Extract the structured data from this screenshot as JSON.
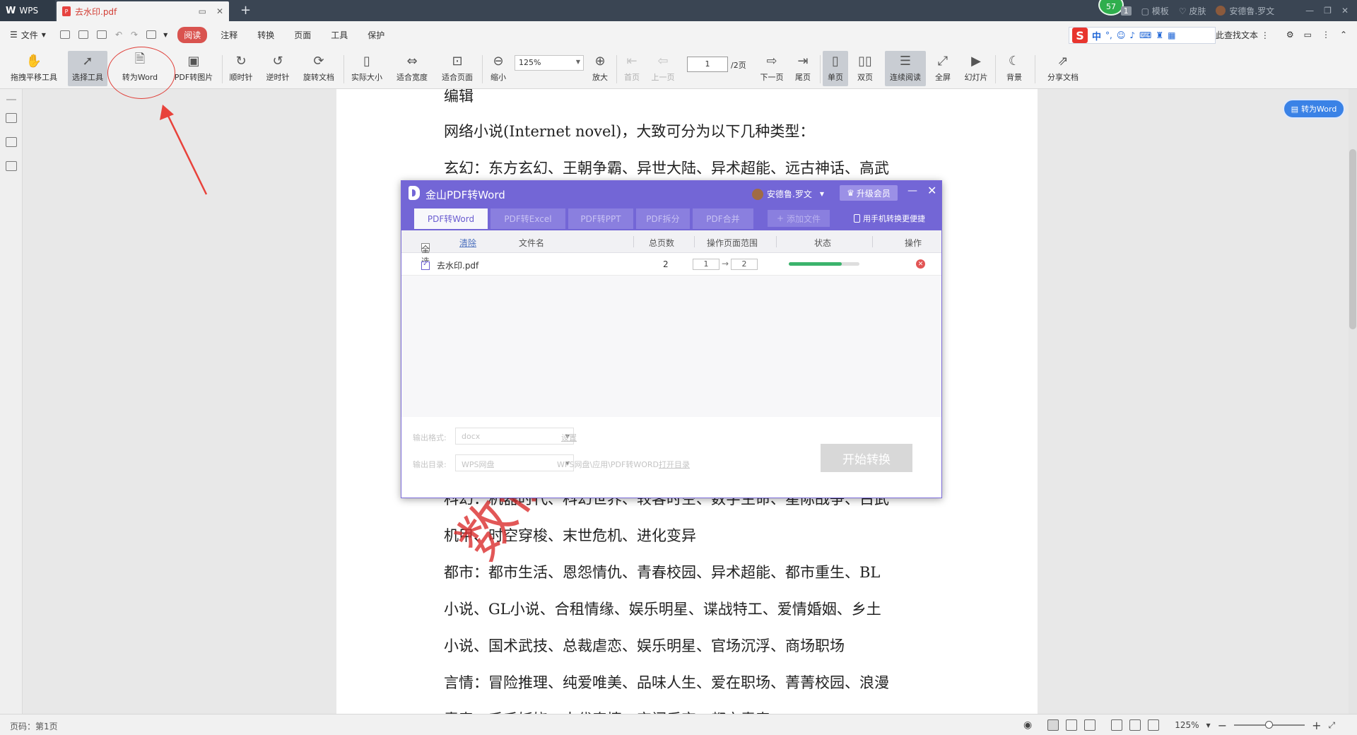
{
  "titlebar": {
    "app_tab": "WPS",
    "doc_tab_title": "去水印.pdf",
    "add_tab": "+",
    "notification_count": "1",
    "green_badge": "57",
    "template": "模板",
    "skin": "皮肤",
    "user_name": "安德鲁.罗文"
  },
  "menubar": {
    "file": "文件",
    "items": [
      "阅读",
      "注释",
      "转换",
      "页面",
      "工具",
      "保护"
    ],
    "find_text": "此查找文本",
    "ime_chinese": "中"
  },
  "toolbar": {
    "tools": [
      {
        "label": "拖拽平移工具",
        "icon": "hand-icon"
      },
      {
        "label": "选择工具",
        "icon": "cursor-icon"
      },
      {
        "label": "转为Word",
        "icon": "pdf-to-word-icon"
      },
      {
        "label": "PDF转图片",
        "icon": "pdf-to-image-icon"
      },
      {
        "label": "顺时针",
        "icon": "rotate-cw-icon"
      },
      {
        "label": "逆时针",
        "icon": "rotate-ccw-icon"
      },
      {
        "label": "旋转文档",
        "icon": "rotate-doc-icon"
      },
      {
        "label": "实际大小",
        "icon": "actual-size-icon"
      },
      {
        "label": "适合宽度",
        "icon": "fit-width-icon"
      },
      {
        "label": "适合页面",
        "icon": "fit-page-icon"
      },
      {
        "label": "缩小",
        "icon": "zoom-out-icon"
      },
      {
        "label": "放大",
        "icon": "zoom-in-icon"
      },
      {
        "label": "首页",
        "icon": "first-page-icon"
      },
      {
        "label": "上一页",
        "icon": "prev-page-icon"
      },
      {
        "label": "下一页",
        "icon": "next-page-icon"
      },
      {
        "label": "尾页",
        "icon": "last-page-icon"
      },
      {
        "label": "单页",
        "icon": "single-page-icon"
      },
      {
        "label": "双页",
        "icon": "double-page-icon"
      },
      {
        "label": "连续阅读",
        "icon": "continuous-icon"
      },
      {
        "label": "全屏",
        "icon": "fullscreen-icon"
      },
      {
        "label": "幻灯片",
        "icon": "slideshow-icon"
      },
      {
        "label": "背景",
        "icon": "moon-icon"
      },
      {
        "label": "分享文档",
        "icon": "share-icon"
      }
    ],
    "zoom_value": "125%",
    "page_current": "1",
    "page_total": "/2页"
  },
  "float_button": "转为Word",
  "document": {
    "lines": [
      "编辑",
      "网络小说(Internet novel)，大致可分为以下几种类型：",
      "玄幻：东方玄幻、王朝争霸、异世大陆、异术超能、远古神话、高武",
      "科幻：机器时代、科幻世界、较客时空、数字生命、星际战争、古武",
      "机甲、时空穿梭、末世危机、进化变异",
      "都市：都市生活、恩怨情仇、青春校园、异术超能、都市重生、BL",
      "小说、GL小说、合租情缘、娱乐明星、谍战特工、爱情婚姻、乡土",
      "小说、国术武技、总裁虐恋、娱乐明星、官场沉浮、商场职场",
      "言情：冒险推理、纯爱唯美、品味人生、爱在职场、菁菁校园、浪漫",
      "青春、千千妖娆、古代奇情、宫闱后宅、都市青春"
    ],
    "watermark": "数依使用WPS"
  },
  "dialog": {
    "title": "金山PDF转Word",
    "user": "安德鲁.罗文",
    "vip": "升级会员",
    "tabs": [
      "PDF转Word",
      "PDF转Excel",
      "PDF转PPT",
      "PDF拆分",
      "PDF合并"
    ],
    "add_file": "添加文件",
    "phone_convert": "用手机转换更便捷",
    "columns": {
      "select_all": "全选",
      "clear": "清除",
      "filename": "文件名",
      "pages": "总页数",
      "range": "操作页面范围",
      "status": "状态",
      "action": "操作"
    },
    "rows": [
      {
        "filename": "去水印.pdf",
        "pages": "2",
        "range_from": "1",
        "range_to": "2",
        "progress": 0.75
      }
    ],
    "output_format_label": "输出格式:",
    "output_format_value": "docx",
    "settings": "设置",
    "output_dir_label": "输出目录:",
    "output_dir_value": "WPS网盘",
    "output_path": "WPS网盘\\应用\\PDF转WORD",
    "open_dir": "打开目录",
    "start_button": "开始转换"
  },
  "statusbar": {
    "page_info": "页码：第1页",
    "zoom": "125%"
  },
  "colors": {
    "accent_purple": "#7366d6",
    "annotation_red": "#e0403a",
    "read_active": "#d9534f"
  }
}
